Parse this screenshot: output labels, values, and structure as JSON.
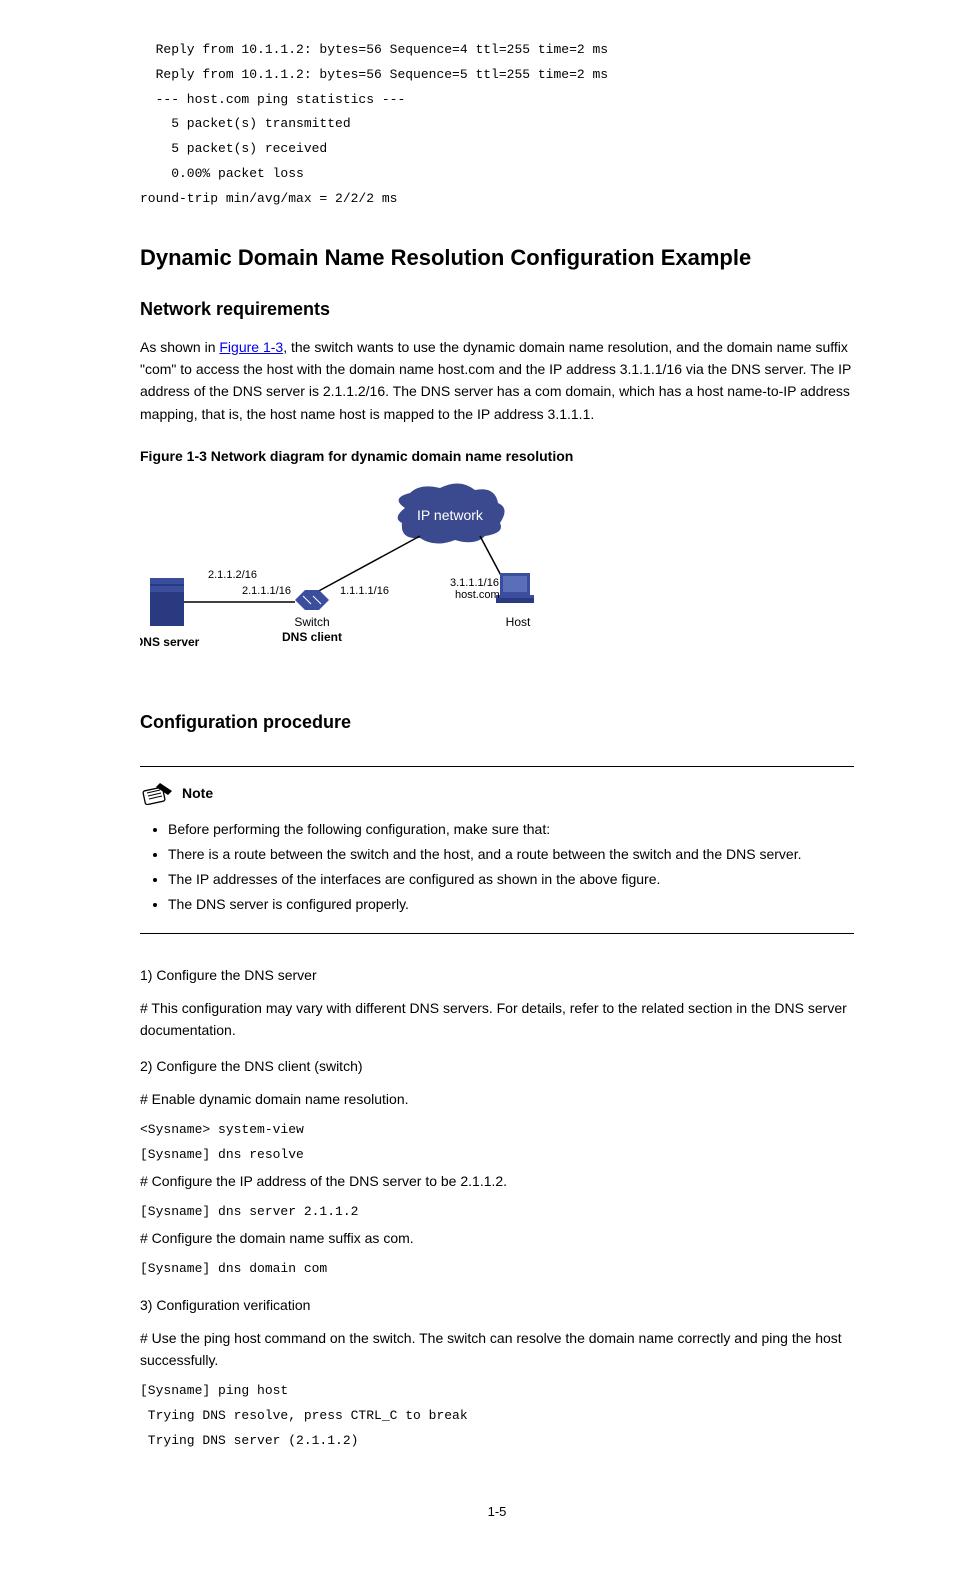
{
  "code": {
    "line1": "  Reply from 10.1.1.2: bytes=56 Sequence=4 ttl=255 time=2 ms",
    "line2": "  Reply from 10.1.1.2: bytes=56 Sequence=5 ttl=255 time=2 ms",
    "line3": "",
    "line4": "  --- host.com ping statistics ---",
    "line5": "    5 packet(s) transmitted",
    "line6": "    5 packet(s) received",
    "line7": "    0.00% packet loss ",
    "line8": "round-trip min/avg/max = 2/2/2 ms "
  },
  "headings": {
    "h1": "Dynamic Domain Name Resolution Configuration Example",
    "h2_net": "Network requirements",
    "h2_proc": "Configuration procedure"
  },
  "paragraphs": {
    "intro_before_link": "As shown in ",
    "intro_link": "Figure 1-3",
    "intro_after_link": ", the switch wants to use the dynamic domain name resolution, and the domain name suffix \"com\" to access the host with the domain name host.com and the IP address 3.1.1.1/16 via the DNS server. The IP address of the DNS server is 2.1.1.2/16. The DNS server has a com domain, which has a host name-to-IP address mapping, that is, the host name host is mapped to the IP address 3.1.1.1.",
    "fig_caption": "Figure 1-3 Network diagram for dynamic domain name resolution",
    "note_label": "Note",
    "step1": "1)   Configure the DNS server",
    "step1_body": "# This configuration may vary with different DNS servers. For details, refer to the related section in the DNS server documentation.",
    "step2": "2)   Configure the DNS client (switch)",
    "step2_a": "# Enable dynamic domain name resolution.",
    "cfg1a": "<Sysname> system-view ",
    "cfg1b": "[Sysname] dns resolve ",
    "step2_b": "# Configure the IP address of the DNS server to be 2.1.1.2.",
    "cfg2": "[Sysname] dns server 2.1.1.2 ",
    "step2_c": "# Configure the domain name suffix as com.",
    "cfg3": "[Sysname] dns domain com ",
    "step3": "3)   Configuration verification",
    "step3_body": "# Use the ping host command on the switch. The switch can resolve the domain name correctly and ping the host successfully.",
    "cfg4a": "[Sysname] ping host ",
    "cfg4b": " Trying DNS resolve, press CTRL_C to break ",
    "cfg4c": " Trying DNS server (2.1.1.2) ",
    "page_num": "1-5"
  },
  "bullets": {
    "b1": "Before performing the following configuration, make sure that:",
    "b2": "There is a route between the switch and the host, and a route between the switch and the DNS server.",
    "b3": "The IP addresses of the interfaces are configured as shown in the above figure.",
    "b4": "The DNS server is configured properly."
  },
  "diagram": {
    "ip_network": "IP network",
    "dns_server_label": "DNS server",
    "dns_server_ip": "2.1.1.2/16",
    "switch_ip_left": "2.1.1.1/16",
    "switch_ip_right": "1.1.1.1/16",
    "switch_label_top": "Switch",
    "switch_label_bottom": "DNS client",
    "host_ip": "3.1.1.1/16",
    "host_domain": "host.com",
    "host_label": "Host"
  }
}
